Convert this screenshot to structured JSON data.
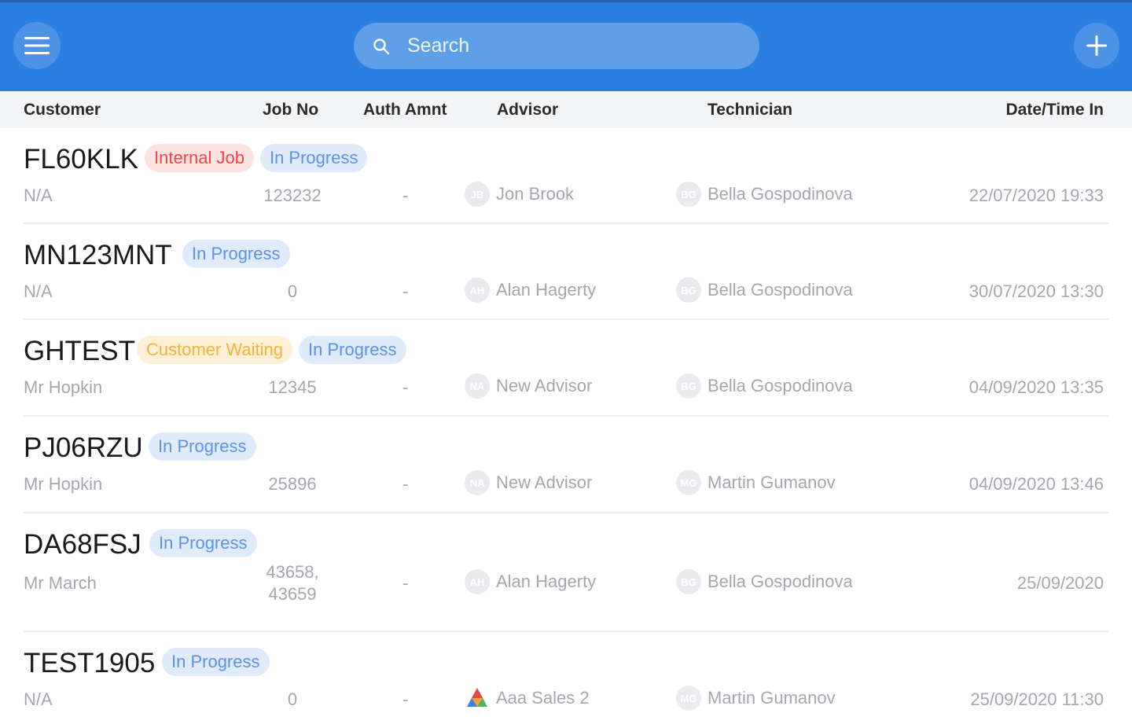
{
  "colors": {
    "accent": "#2a7fe0",
    "internal": "#f0464a",
    "progress": "#5a92ea",
    "waiting": "#f6b13a"
  },
  "search": {
    "placeholder": "Search"
  },
  "columns": {
    "customer": "Customer",
    "job_no": "Job No",
    "auth_amnt": "Auth Amnt",
    "advisor": "Advisor",
    "technician": "Technician",
    "date_time_in": "Date/Time In"
  },
  "jobs": [
    {
      "reg": "FL60KLK",
      "badges": [
        "Internal Job",
        "In Progress"
      ],
      "customer": "N/A",
      "job_no": "123232",
      "auth_amnt": "-",
      "advisor": {
        "initials": "JB",
        "name": "Jon Brook"
      },
      "technician": {
        "initials": "BG",
        "name": "Bella Gospodinova"
      },
      "date_in": "22/07/2020 19:33"
    },
    {
      "reg": "MN123MNT",
      "badges": [
        "In Progress"
      ],
      "customer": "N/A",
      "job_no": "0",
      "auth_amnt": "-",
      "advisor": {
        "initials": "AH",
        "name": "Alan Hagerty"
      },
      "technician": {
        "initials": "BG",
        "name": "Bella Gospodinova"
      },
      "date_in": "30/07/2020 13:30"
    },
    {
      "reg": "GHTEST",
      "badges": [
        "Customer Waiting",
        "In Progress"
      ],
      "customer": "Mr Hopkin",
      "job_no": "12345",
      "auth_amnt": "-",
      "advisor": {
        "initials": "NA",
        "name": "New Advisor"
      },
      "technician": {
        "initials": "BG",
        "name": "Bella Gospodinova"
      },
      "date_in": "04/09/2020 13:35"
    },
    {
      "reg": "PJ06RZU",
      "badges": [
        "In Progress"
      ],
      "customer": "Mr Hopkin",
      "job_no": "25896",
      "auth_amnt": "-",
      "advisor": {
        "initials": "NA",
        "name": "New Advisor"
      },
      "technician": {
        "initials": "MG",
        "name": "Martin Gumanov"
      },
      "date_in": "04/09/2020 13:46"
    },
    {
      "reg": "DA68FSJ",
      "badges": [
        "In Progress"
      ],
      "customer": "Mr March",
      "job_no_lines": [
        "43658,",
        "43659"
      ],
      "auth_amnt": "-",
      "advisor": {
        "initials": "AH",
        "name": "Alan Hagerty"
      },
      "technician": {
        "initials": "BG",
        "name": "Bella Gospodinova"
      },
      "date_in": "25/09/2020"
    },
    {
      "reg": "TEST1905",
      "badges": [
        "In Progress"
      ],
      "customer": "N/A",
      "job_no": "0",
      "auth_amnt": "-",
      "advisor": {
        "icon": "logo-icon",
        "name": "Aaa Sales 2"
      },
      "technician": {
        "initials": "MG",
        "name": "Martin Gumanov"
      },
      "date_in": "25/09/2020 11:30"
    }
  ]
}
